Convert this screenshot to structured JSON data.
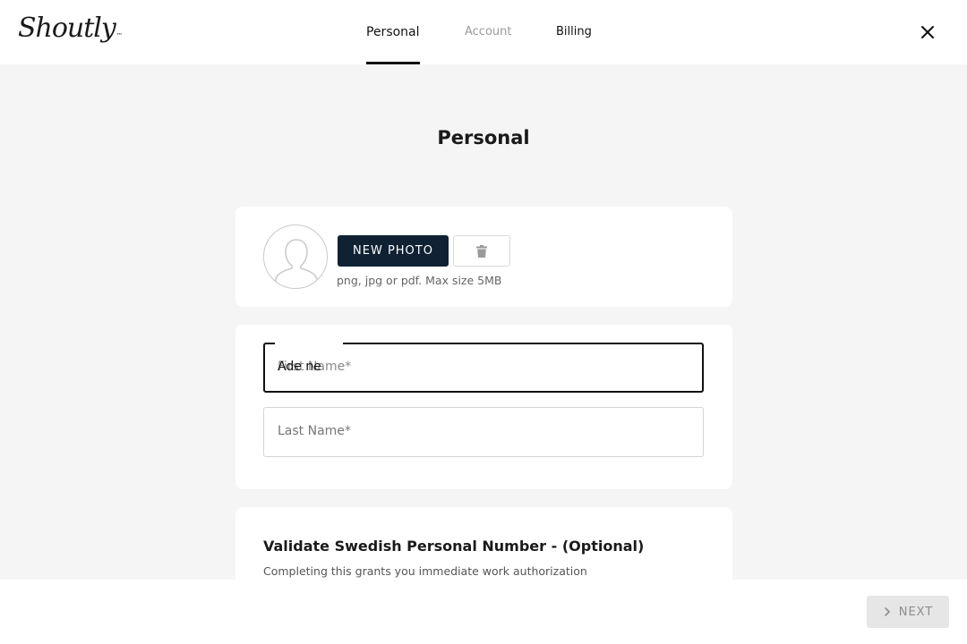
{
  "header": {
    "logo_text": "Shoutly",
    "logo_mark": "™",
    "tabs": [
      {
        "label": "Personal",
        "state": "active"
      },
      {
        "label": "Account",
        "state": "disabled"
      },
      {
        "label": "Billing",
        "state": "enabled"
      }
    ],
    "close_icon": "close-icon"
  },
  "page": {
    "title": "Personal"
  },
  "photo": {
    "avatar_icon": "user-placeholder-icon",
    "new_photo_label": "NEW PHOTO",
    "delete_icon": "trash-icon",
    "hint": "png, jpg or pdf. Max size 5MB"
  },
  "name_form": {
    "first_name_label": "First Name*",
    "first_name_value": "Ade ne",
    "last_name_label": "Last Name*",
    "last_name_value": ""
  },
  "validation": {
    "title": "Validate Swedish Personal Number - (Optional)",
    "subtitle": "Completing this grants you immediate work authorization"
  },
  "footer": {
    "next_label": "NEXT",
    "next_icon": "chevron-right-icon"
  },
  "colors": {
    "primary_button": "#0f2133",
    "background": "#f5f5f5",
    "disabled_button": "#e6e6e6"
  }
}
